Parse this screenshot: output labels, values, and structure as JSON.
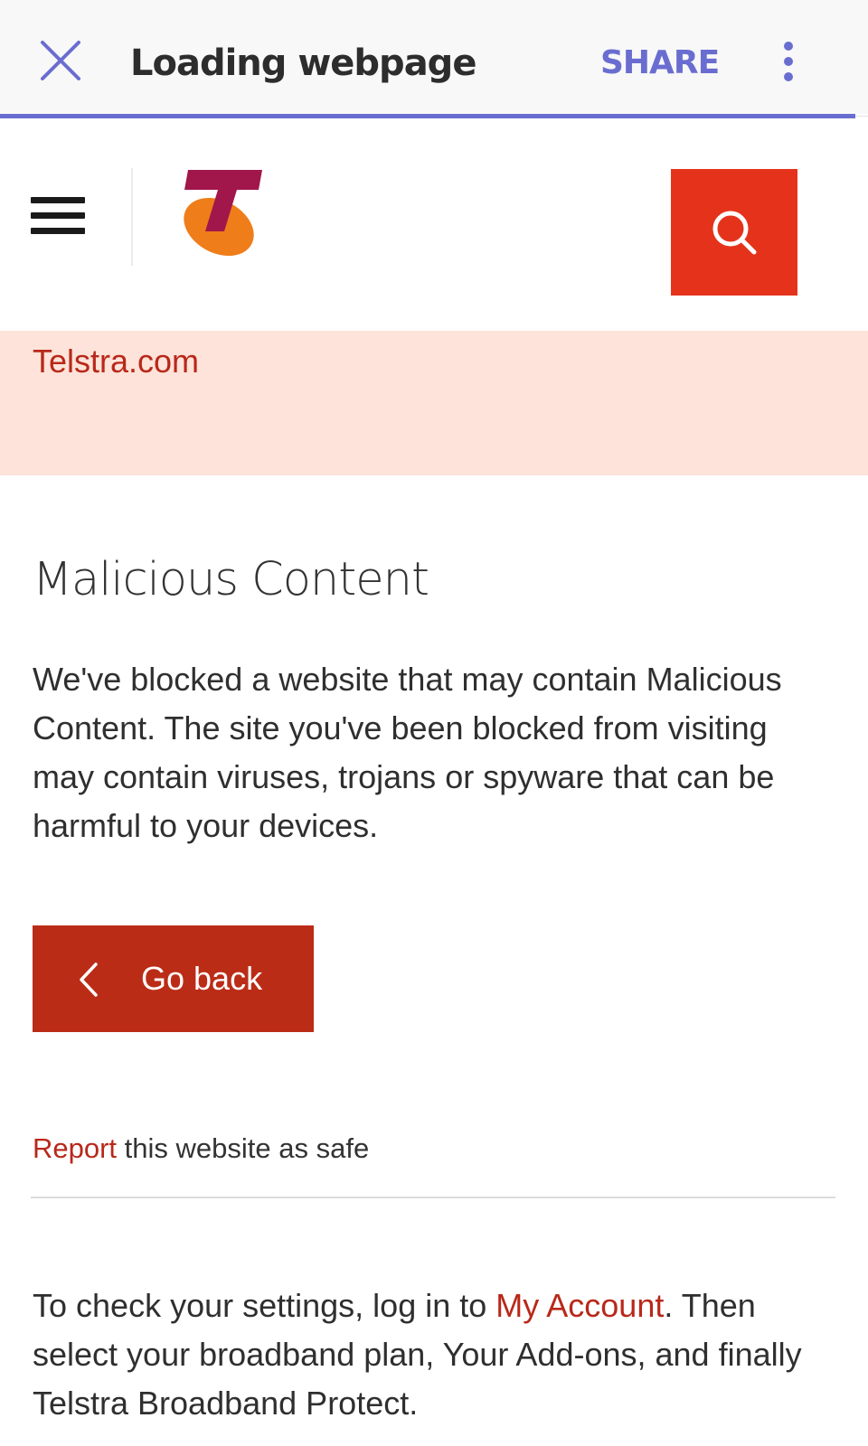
{
  "browser_bar": {
    "title": "Loading webpage",
    "share_label": "SHARE",
    "close_icon": "close-icon",
    "more_icon": "more-vertical-icon",
    "accent_color": "#6a6dd0",
    "load_progress_percent": 98.5
  },
  "header": {
    "menu_icon": "hamburger-menu-icon",
    "logo": "telstra-logo",
    "search_icon": "search-icon",
    "search_bg": "#e5331b"
  },
  "breadcrumb": {
    "label": "Telstra.com"
  },
  "main": {
    "heading": "Malicious Content",
    "description": "We've blocked a website that may contain Malicious Content. The site you've been blocked from visiting may contain viruses, trojans or spyware that can be harmful to your devices.",
    "go_back_label": "Go back",
    "go_back_icon": "chevron-left-icon",
    "report_link": "Report",
    "report_rest": " this website as safe",
    "footer": {
      "before": "To check your settings, log in to ",
      "link": "My Account",
      "after": ". Then select your broadband plan, Your Add-ons, and finally Telstra Broadband Protect."
    }
  },
  "colors": {
    "brand_red": "#bb2c17",
    "link_red": "#b8281a",
    "band_bg": "#fde3d9"
  }
}
